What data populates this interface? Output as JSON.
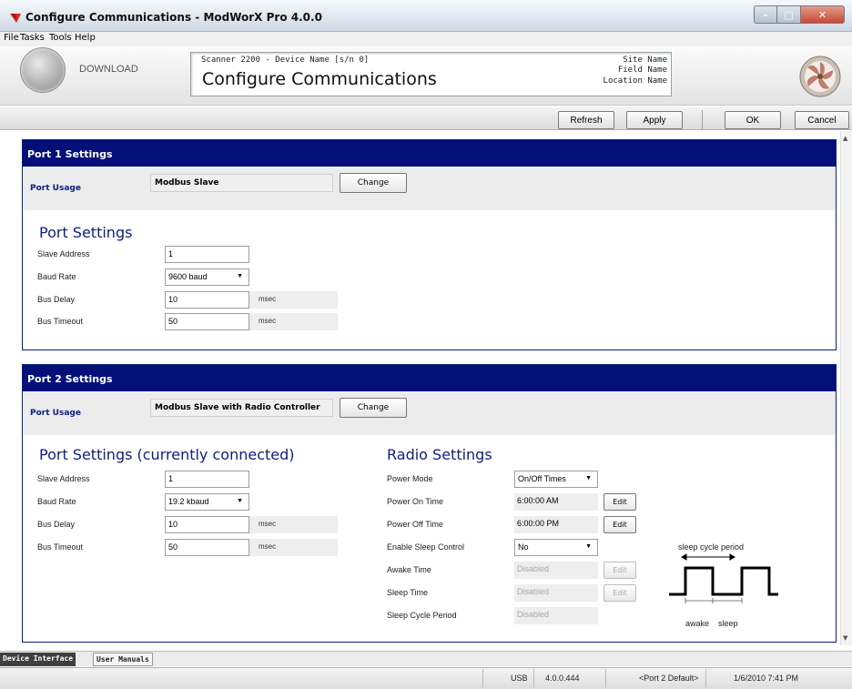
{
  "window": {
    "title": "Configure Communications - ModWorX Pro 4.0.0",
    "minimize": "–",
    "maximize": "□",
    "close": "✕"
  },
  "menu": [
    "File",
    "Tasks",
    "Tools",
    "Help"
  ],
  "header": {
    "download_label": "DOWNLOAD",
    "device_line": "Scanner 2200 - Device Name [s/n 0]",
    "page_title": "Configure Communications",
    "site_name": "Site Name",
    "field_name": "Field Name",
    "location_name": "Location Name"
  },
  "toolbar": {
    "refresh": "Refresh",
    "apply": "Apply",
    "ok": "OK",
    "cancel": "Cancel"
  },
  "port1": {
    "header": "Port 1 Settings",
    "usage_label": "Port Usage",
    "usage_value": "Modbus Slave",
    "change": "Change",
    "settings_title": "Port Settings",
    "slave_address_label": "Slave Address",
    "slave_address": "1",
    "baud_rate_label": "Baud Rate",
    "baud_rate": "9600 baud",
    "bus_delay_label": "Bus Delay",
    "bus_delay": "10",
    "bus_delay_unit": "msec",
    "bus_timeout_label": "Bus Timeout",
    "bus_timeout": "50",
    "bus_timeout_unit": "msec"
  },
  "port2": {
    "header": "Port 2 Settings",
    "usage_label": "Port Usage",
    "usage_value": "Modbus Slave with Radio Controller",
    "change": "Change",
    "settings_title": "Port Settings (currently connected)",
    "slave_address_label": "Slave Address",
    "slave_address": "1",
    "baud_rate_label": "Baud Rate",
    "baud_rate": "19.2 kbaud",
    "bus_delay_label": "Bus Delay",
    "bus_delay": "10",
    "bus_delay_unit": "msec",
    "bus_timeout_label": "Bus Timeout",
    "bus_timeout": "50",
    "bus_timeout_unit": "msec"
  },
  "radio": {
    "title": "Radio Settings",
    "power_mode_label": "Power Mode",
    "power_mode": "On/Off Times",
    "power_on_label": "Power On Time",
    "power_on": "6:00:00 AM",
    "power_off_label": "Power Off Time",
    "power_off": "6:00:00 PM",
    "sleep_control_label": "Enable Sleep Control",
    "sleep_control": "No",
    "awake_time_label": "Awake Time",
    "awake_time": "Disabled",
    "sleep_time_label": "Sleep Time",
    "sleep_time": "Disabled",
    "sleep_cycle_label": "Sleep Cycle Period",
    "sleep_cycle": "Disabled",
    "edit": "Edit",
    "diagram_title": "sleep cycle period",
    "diagram_awake": "awake",
    "diagram_sleep": "sleep"
  },
  "bottom_tabs": [
    "Device Interface",
    "User Manuals"
  ],
  "status": {
    "connection": "USB",
    "version": "4.0.0.444",
    "port": "<Port 2 Default>",
    "datetime": "1/6/2010 7:41 PM"
  },
  "colors": {
    "section_header": "#040f78",
    "label_blue": "#10207e"
  }
}
